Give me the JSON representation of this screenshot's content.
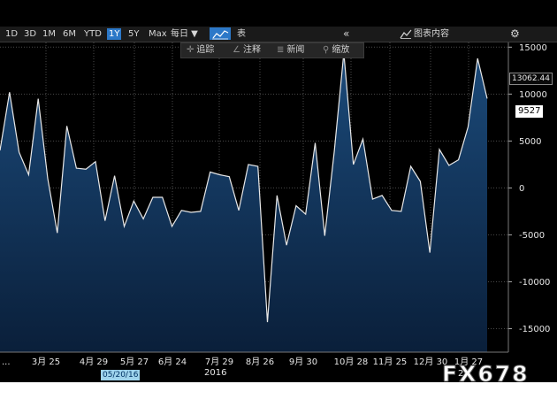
{
  "toolbar": {
    "ranges": [
      "1D",
      "3D",
      "1M",
      "6M",
      "YTD",
      "1Y",
      "5Y",
      "Max"
    ],
    "active_range": "1Y",
    "frequency": "每日 ▼",
    "table_label": "表",
    "collapse_symbol": "«",
    "content_label": "图表内容",
    "settings_symbol": "⚙"
  },
  "tools": {
    "track": "追踪",
    "annotate": "注释",
    "news": "新闻",
    "zoom": "缩放"
  },
  "chart_data": {
    "type": "area",
    "title": "",
    "xlabel": "",
    "ylabel": "",
    "ylim": [
      -17500,
      15500
    ],
    "y_ticks": [
      15000,
      10000,
      5000,
      0,
      -5000,
      -10000,
      -15000
    ],
    "y_tick_labels": [
      "15000",
      "10000",
      "5000",
      "0",
      "-5000",
      "-10000",
      "-15000"
    ],
    "x_tick_labels": [
      "3月 25",
      "4月 29",
      "5月 27",
      "6月 24",
      "7月 29",
      "8月 26",
      "9月 30",
      "10月 28",
      "11月 25",
      "12月 30",
      "1月 27"
    ],
    "year_label": "2016",
    "year_label_2": "20",
    "left_ellipsis": "...",
    "cursor_date": "05/20/16",
    "last_value_label": "13062.44",
    "current_value_label": "9527",
    "series": [
      {
        "values": [
          4000,
          10200,
          3800,
          1400,
          9500,
          1000,
          -4800,
          6600,
          2100,
          2000,
          2800,
          -3500,
          1300,
          -4100,
          -1400,
          -3300,
          -1000,
          -1000,
          -4100,
          -2400,
          -2600,
          -2500,
          1700,
          1400,
          1200,
          -2400,
          2500,
          2300,
          -14300,
          -800,
          -6100,
          -1900,
          -2800,
          4800,
          -5100,
          3900,
          14400,
          2500,
          5200,
          -1200,
          -800,
          -2400,
          -2500,
          2300,
          700,
          -6900,
          4100,
          2400,
          3000,
          6500,
          13800,
          9527
        ]
      }
    ],
    "line_color": "#e8e8e8",
    "fill_color_top": "#1b4a7a",
    "fill_color_bottom": "#0a1f3a",
    "grid": true
  },
  "watermark": "FX678"
}
